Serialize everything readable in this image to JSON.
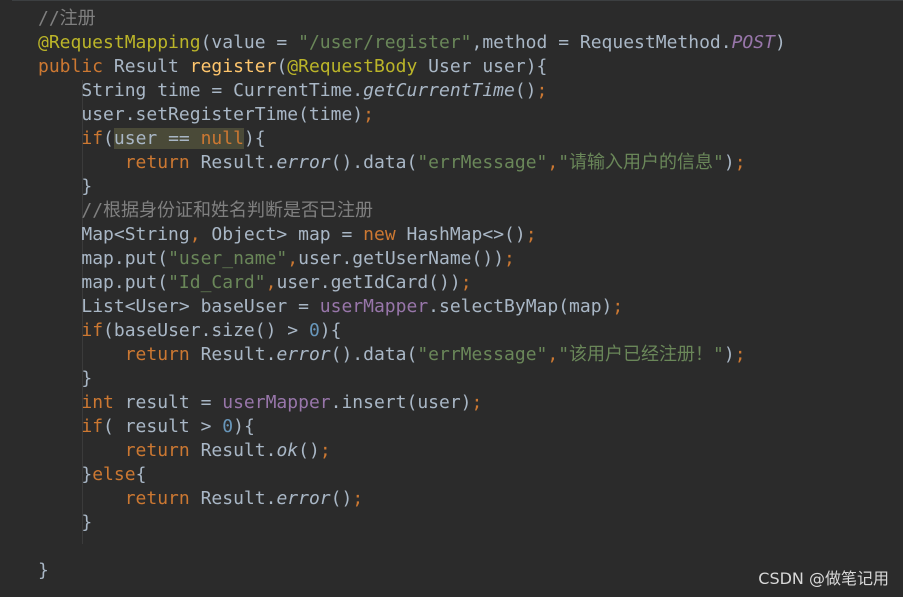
{
  "code": {
    "l1": "//注册",
    "l2_ann": "@RequestMapping",
    "l2_a": "(value = ",
    "l2_str": "\"/user/register\"",
    "l2_b": ",method = RequestMethod.",
    "l2_post": "POST",
    "l2_c": ")",
    "l3_pub": "public",
    "l3_a": " Result ",
    "l3_fn": "register",
    "l3_b": "(",
    "l3_ann": "@RequestBody",
    "l3_c": " User user){",
    "l4_a": "String time = CurrentTime.",
    "l4_call": "getCurrentTime",
    "l4_b": "()",
    "l4_semi": ";",
    "l5_a": "user.setRegisterTime(time)",
    "l5_semi": ";",
    "l6_if": "if",
    "l6_a": "(",
    "l6_hl1": "user == ",
    "l6_null": "null",
    "l6_b": "){",
    "l7_ret": "return",
    "l7_a": " Result.",
    "l7_err": "error",
    "l7_b": "().data(",
    "l7_s1": "\"errMessage\"",
    "l7_comma": ",",
    "l7_s2": "\"请输入用户的信息\"",
    "l7_c": ")",
    "l7_semi": ";",
    "l8": "}",
    "l9": "//根据身份证和姓名判断是否已注册",
    "l10_a": "Map<String",
    "l10_comma": ",",
    "l10_b": " Object> map = ",
    "l10_new": "new",
    "l10_c": " HashMap<>()",
    "l10_semi": ";",
    "l11_a": "map.put(",
    "l11_s": "\"user_name\"",
    "l11_comma": ",",
    "l11_b": "user.getUserName())",
    "l11_semi": ";",
    "l12_a": "map.put(",
    "l12_s": "\"Id_Card\"",
    "l12_comma": ",",
    "l12_b": "user.getIdCard())",
    "l12_semi": ";",
    "l13_a": "List<User> baseUser = ",
    "l13_fld": "userMapper",
    "l13_b": ".selectByMap(map)",
    "l13_semi": ";",
    "l14_if": "if",
    "l14_a": "(baseUser.size() > ",
    "l14_num": "0",
    "l14_b": "){",
    "l15_ret": "return",
    "l15_a": " Result.",
    "l15_err": "error",
    "l15_b": "().data(",
    "l15_s1": "\"errMessage\"",
    "l15_comma": ",",
    "l15_s2": "\"该用户已经注册！\"",
    "l15_c": ")",
    "l15_semi": ";",
    "l16": "}",
    "l17_int": "int",
    "l17_a": " result = ",
    "l17_fld": "userMapper",
    "l17_b": ".insert(user)",
    "l17_semi": ";",
    "l18_if": "if",
    "l18_a": "( result > ",
    "l18_num": "0",
    "l18_b": "){",
    "l19_ret": "return",
    "l19_a": " Result.",
    "l19_ok": "ok",
    "l19_b": "()",
    "l19_semi": ";",
    "l20_a": "}",
    "l20_else": "else",
    "l20_b": "{",
    "l21_ret": "return",
    "l21_a": " Result.",
    "l21_err": "error",
    "l21_b": "()",
    "l21_semi": ";",
    "l22": "}",
    "l24": "}"
  },
  "watermark": "CSDN @做笔记用",
  "colors": {
    "background": "#2b2b2b",
    "keyword": "#cc7832",
    "annotation": "#bbb529",
    "string": "#6a8759",
    "comment": "#808080",
    "field": "#9876aa",
    "method_decl": "#ffc66d",
    "number": "#6897bb",
    "default": "#a9b7c6"
  }
}
